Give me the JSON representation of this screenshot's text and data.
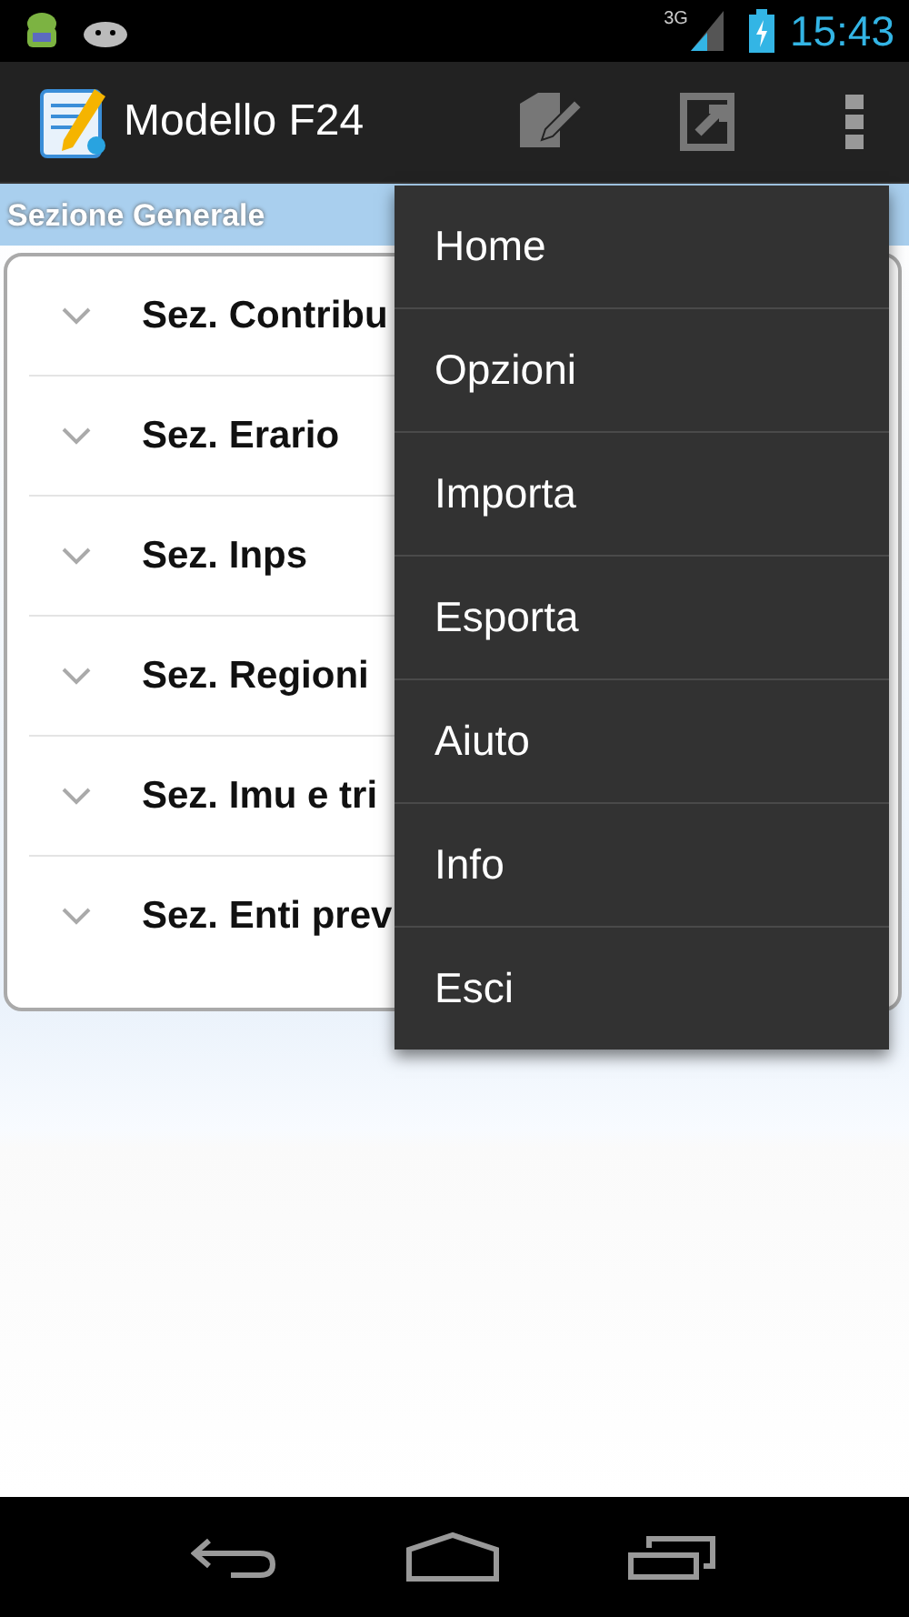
{
  "status_bar": {
    "network": "3G",
    "time": "15:43"
  },
  "action_bar": {
    "title": "Modello F24"
  },
  "section_header": "Sezione Generale",
  "sections": [
    {
      "label": "Sez. Contribu",
      "expanded": false
    },
    {
      "label": "Sez. Erario",
      "expanded": false
    },
    {
      "label": "Sez. Inps",
      "expanded": false
    },
    {
      "label": "Sez. Regioni",
      "expanded": false
    },
    {
      "label": "Sez. Imu e tri",
      "expanded": false
    },
    {
      "label": "Sez. Enti prev",
      "expanded": false
    }
  ],
  "menu": [
    "Home",
    "Opzioni",
    "Importa",
    "Esporta",
    "Aiuto",
    "Info",
    "Esci"
  ]
}
